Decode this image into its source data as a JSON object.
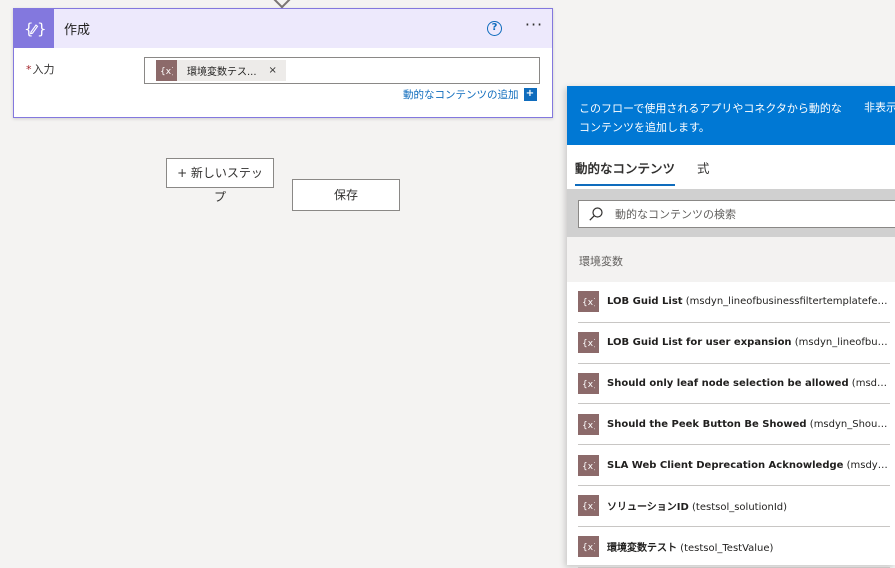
{
  "compose_card": {
    "title": "作成",
    "help_glyph": "?",
    "more_glyph": "···",
    "input_label": "入力",
    "required_mark": "*",
    "token": {
      "label": "環境変数テス...",
      "icon": "variable-icon",
      "close": "×"
    },
    "add_dynamic_content": "動的なコンテンツの追加",
    "add_glyph": "+"
  },
  "new_step_button": {
    "label": "+ 新しいステッ",
    "overflow": "プ"
  },
  "save_button": {
    "label": "保存"
  },
  "dynamic_panel": {
    "banner_text": "このフローで使用されるアプリやコネクタから動的なコンテンツを追加します。",
    "hide_label": "非表示",
    "tabs": [
      {
        "label": "動的なコンテンツ",
        "active": true
      },
      {
        "label": "式",
        "active": false
      }
    ],
    "search_placeholder": "動的なコンテンツの検索",
    "group_label": "環境変数",
    "items": [
      {
        "name": "LOB Guid List",
        "detail": " (msdyn_lineofbusinessfiltertemplatefeatu..."
      },
      {
        "name": "LOB Guid List for user expansion",
        "detail": " (msdyn_lineofbusiness..."
      },
      {
        "name": "Should only leaf node selection be allowed",
        "detail": " (msdyn_Allo..."
      },
      {
        "name": "Should the Peek Button Be Showed",
        "detail": " (msdyn_ShouldSho..."
      },
      {
        "name": "SLA Web Client Deprecation Acknowledge",
        "detail": " (msdyn_SLA..."
      },
      {
        "name": "ソリューションID",
        "detail": " (testsol_solutionId)"
      },
      {
        "name": "環境変数テスト",
        "detail": " (testsol_TestValue)"
      }
    ]
  },
  "colors": {
    "action_accent": "#8378de",
    "action_header_bg": "#ede9fc",
    "banner_blue": "#0078d4",
    "link_blue": "#0f6cbd",
    "variable_icon_bg": "#8c6a6a"
  }
}
